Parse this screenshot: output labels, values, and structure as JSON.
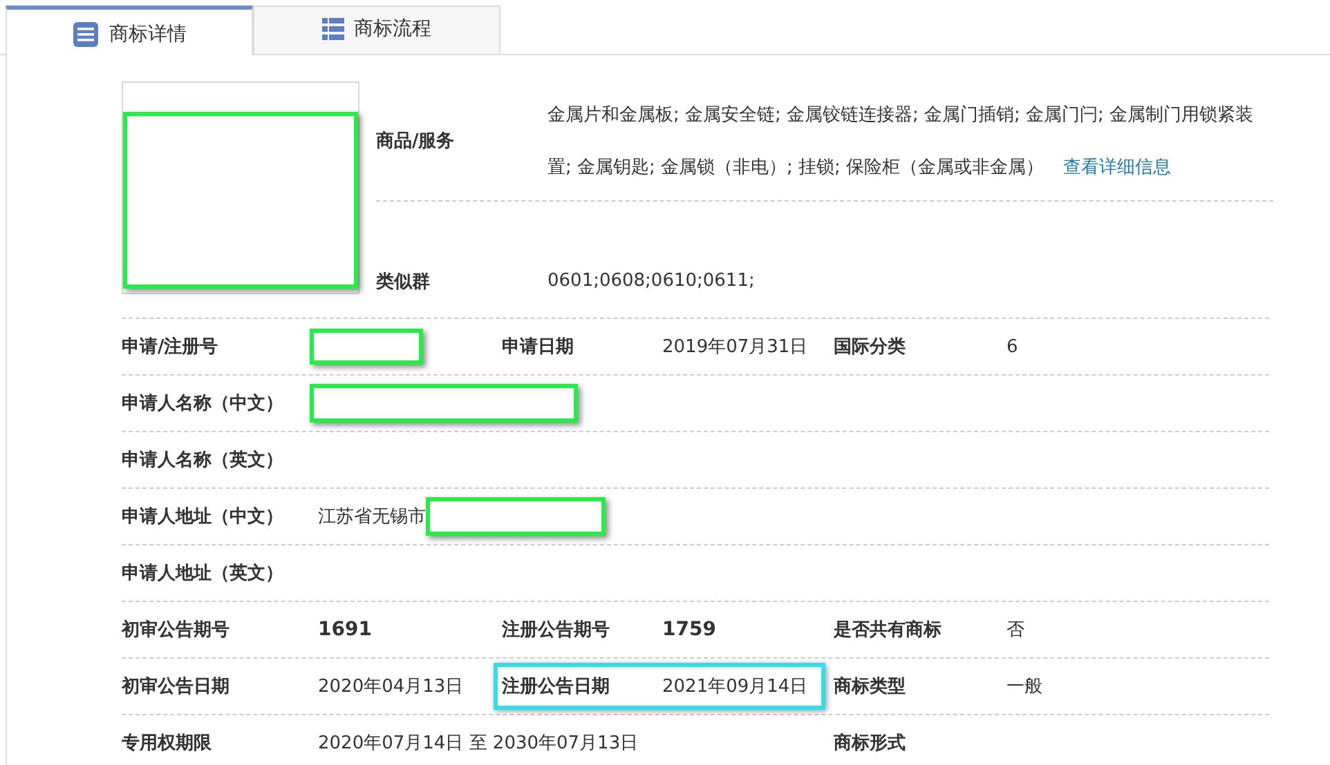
{
  "tabs": [
    {
      "label": "商标详情",
      "selected": true,
      "kind": "detail"
    },
    {
      "label": "商标流程",
      "selected": false,
      "kind": "flow"
    }
  ],
  "trademark_image": {
    "redacted": true
  },
  "goods": {
    "label": "商品/服务",
    "text": "金属片和金属板; 金属安全链; 金属铰链连接器; 金属门插销; 金属门闩; 金属制门用锁紧装置; 金属钥匙; 金属锁（非电）; 挂锁; 保险柜（金属或非金属）",
    "link": "查看详细信息"
  },
  "similar_group": {
    "label": "类似群",
    "value": "0601;0608;0610;0611;"
  },
  "rows": [
    {
      "fields": [
        {
          "label": "申请/注册号",
          "redacted": true
        },
        {
          "label": "申请日期",
          "value": "2019年07月31日"
        },
        {
          "label": "国际分类",
          "value": "6"
        }
      ]
    },
    {
      "fields": [
        {
          "label": "申请人名称（中文）",
          "redacted": true
        }
      ]
    },
    {
      "fields": [
        {
          "label": "申请人名称（英文）"
        }
      ]
    },
    {
      "fields": [
        {
          "label": "申请人地址（中文）",
          "value": "江苏省无锡市",
          "redacted": true
        }
      ]
    },
    {
      "fields": [
        {
          "label": "申请人地址（英文）"
        }
      ]
    },
    {
      "fields": [
        {
          "label": "初审公告期号",
          "value": "1691",
          "bold": true
        },
        {
          "label": "注册公告期号",
          "value": "1759",
          "bold": true
        },
        {
          "label": "是否共有商标",
          "value": "否"
        }
      ]
    },
    {
      "fields": [
        {
          "label": "初审公告日期",
          "value": "2020年04月13日"
        },
        {
          "label": "注册公告日期",
          "value": "2021年09月14日",
          "highlighted": true
        },
        {
          "label": "商标类型",
          "value": "一般"
        }
      ]
    },
    {
      "fields": [
        {
          "label": "专用权期限",
          "value": "2020年07月14日 至 2030年07月13日"
        },
        {
          "label": "商标形式"
        }
      ]
    }
  ]
}
